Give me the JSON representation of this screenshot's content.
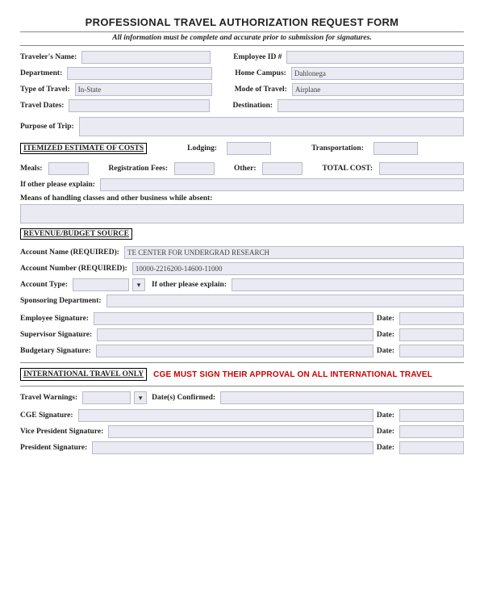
{
  "title": "PROFESSIONAL TRAVEL AUTHORIZATION REQUEST FORM",
  "subtitle": "All information must be complete and accurate prior to submission for signatures.",
  "labels": {
    "traveler_name": "Traveler's Name:",
    "employee_id": "Employee ID #",
    "department": "Department:",
    "home_campus": "Home Campus:",
    "type_of_travel": "Type of Travel:",
    "mode_of_travel": "Mode of Travel:",
    "travel_dates": "Travel Dates:",
    "destination": "Destination:",
    "purpose": "Purpose of Trip:",
    "itemized_hdr": "ITEMIZED ESTIMATE OF COSTS",
    "lodging": "Lodging:",
    "transportation": "Transportation:",
    "meals": "Meals:",
    "reg_fees": "Registration Fees:",
    "other": "Other:",
    "total_cost": "TOTAL COST:",
    "other_explain": "If other please explain:",
    "means_handling": "Means of handling classes and other business while absent:",
    "revenue_hdr": "REVENUE/BUDGET SOURCE",
    "account_name": "Account Name (REQUIRED):",
    "account_number": "Account Number (REQUIRED):",
    "account_type": "Account Type:",
    "other_explain2": "If other please explain:",
    "sponsoring_dept": "Sponsoring Department:",
    "employee_sig": "Employee Signature:",
    "supervisor_sig": "Supervisor Signature:",
    "budgetary_sig": "Budgetary Signature:",
    "date": "Date:",
    "intl_hdr": "INTERNATIONAL TRAVEL ONLY",
    "intl_warn": "CGE MUST SIGN THEIR APPROVAL ON ALL INTERNATIONAL TRAVEL",
    "travel_warnings": "Travel Warnings:",
    "dates_confirmed": "Date(s) Confirmed:",
    "cge_sig": "CGE Signature:",
    "vp_sig": "Vice President Signature:",
    "president_sig": "President Signature:"
  },
  "values": {
    "home_campus": "Dahlonega",
    "type_of_travel": "In-State",
    "mode_of_travel": "Airplane",
    "account_name": "TE CENTER FOR UNDERGRAD RESEARCH",
    "account_number": "10000-2216200-14600-11000"
  }
}
